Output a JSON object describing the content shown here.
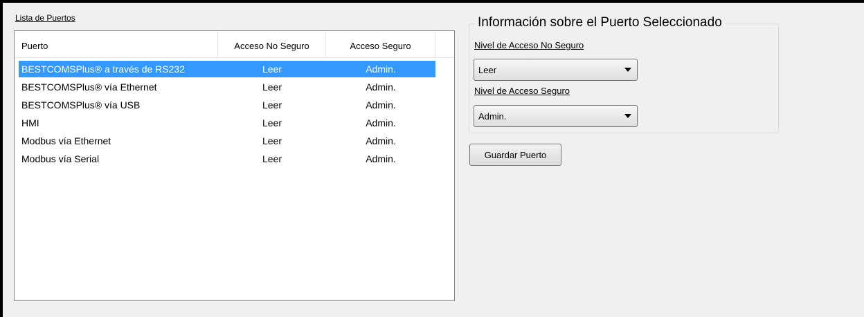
{
  "port_list": {
    "title": "Lista de Puertos",
    "columns": [
      "Puerto",
      "Acceso No Seguro",
      "Acceso Seguro"
    ],
    "rows": [
      {
        "port": "BESTCOMSPlus® a través de RS232",
        "unsecure": "Leer",
        "secure": "Admin.",
        "selected": true
      },
      {
        "port": "BESTCOMSPlus® vía Ethernet",
        "unsecure": "Leer",
        "secure": "Admin.",
        "selected": false
      },
      {
        "port": "BESTCOMSPlus® vía USB",
        "unsecure": "Leer",
        "secure": "Admin.",
        "selected": false
      },
      {
        "port": "HMI",
        "unsecure": "Leer",
        "secure": "Admin.",
        "selected": false
      },
      {
        "port": "Modbus vía Ethernet",
        "unsecure": "Leer",
        "secure": "Admin.",
        "selected": false
      },
      {
        "port": "Modbus vía Serial",
        "unsecure": "Leer",
        "secure": "Admin.",
        "selected": false
      }
    ]
  },
  "port_info": {
    "title": "Información sobre el Puerto Seleccionado",
    "unsecure_label": "Nivel de Acceso No Seguro",
    "unsecure_value": "Leer",
    "secure_label": "Nivel de Acceso Seguro",
    "secure_value": "Admin."
  },
  "actions": {
    "save_port_label": "Guardar Puerto"
  },
  "colors": {
    "selection": "#3399ff",
    "background": "#f0f0f0"
  }
}
